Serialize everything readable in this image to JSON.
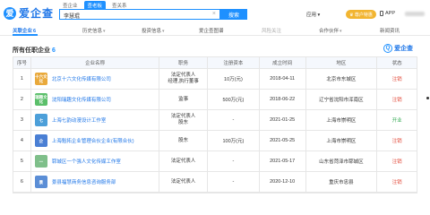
{
  "app": {
    "brand": "爱企查",
    "brand_mark": "爱",
    "search_tabs": [
      "查企业",
      "查老板",
      "查关系"
    ],
    "search_value": "李慧琨",
    "search_clear": "×",
    "search_button": "搜索",
    "app_menu": "应用 ▾",
    "vip_label": "♛ 尊户特惠",
    "app_download": "APP"
  },
  "nav": {
    "items": [
      {
        "label": "关联企业",
        "count": "6",
        "active": true,
        "chevron": ""
      },
      {
        "label": "历史信息",
        "count": "",
        "active": false,
        "chevron": "▾"
      },
      {
        "label": "投资信息",
        "count": "",
        "active": false,
        "chevron": "▾"
      },
      {
        "label": "爱企查图谱",
        "count": "",
        "active": false,
        "chevron": ""
      },
      {
        "label": "风险关注",
        "count": "",
        "active": false,
        "chevron": ""
      },
      {
        "label": "合作伙伴",
        "count": "",
        "active": false,
        "chevron": "▾"
      },
      {
        "label": "新闻资讯",
        "count": "",
        "active": false,
        "chevron": ""
      }
    ]
  },
  "section": {
    "title": "所有任职企业",
    "count": "6",
    "watermark": "爱企查"
  },
  "table": {
    "headers": [
      "序号",
      "企业名称",
      "职务",
      "注册资本",
      "成立时间",
      "地区",
      "状态"
    ],
    "rows": [
      {
        "idx": "1",
        "logo_text": "十六文化",
        "logo_color": "#e9a93b",
        "name": "北京十六文化传媒有限公司",
        "role": [
          "法定代表人",
          "经理,执行董事"
        ],
        "capital": "10万(元)",
        "date": "2018-04-11",
        "region": "北京市东城区",
        "status": "注销",
        "status_color": "red"
      },
      {
        "idx": "2",
        "logo_text": "瑞趣文化",
        "logo_color": "#5bbf6a",
        "name": "沈阳瑞趣文化传媒有限公司",
        "role": [
          "监事"
        ],
        "capital": "500万(元)",
        "date": "2018-06-22",
        "region": "辽宁省沈阳市浑南区",
        "status": "注销",
        "status_color": "red"
      },
      {
        "idx": "3",
        "logo_text": "七",
        "logo_color": "#4c9fd9",
        "name": "上海七韵动漫设计工作室",
        "role": [
          "法定代表人",
          "股东"
        ],
        "capital": "-",
        "date": "2021-01-25",
        "region": "上海市崇明区",
        "status": "开业",
        "status_color": "green"
      },
      {
        "idx": "4",
        "logo_text": "企",
        "logo_color": "#4a7fd4",
        "name": "上海魁拓企业管理合伙企业(有限合伙)",
        "role": [
          "股东"
        ],
        "capital": "100万(元)",
        "date": "2021-05-25",
        "region": "上海市崇明区",
        "status": "注销",
        "status_color": "red"
      },
      {
        "idx": "5",
        "logo_text": "一",
        "logo_color": "#7fbf8a",
        "name": "郓城区一个强人文化传媒工作室",
        "role": [
          "法定代表人"
        ],
        "capital": "-",
        "date": "2021-05-17",
        "region": "山东省菏泽市郓城区",
        "status": "注销",
        "status_color": "red"
      },
      {
        "idx": "6",
        "logo_text": "景",
        "logo_color": "#5b8ed6",
        "name": "景县福慧商务信息咨询服务部",
        "role": [
          "法定代表人"
        ],
        "capital": "-",
        "date": "2020-12-10",
        "region": "重庆市忠县",
        "status": "注销",
        "status_color": "red"
      }
    ]
  }
}
